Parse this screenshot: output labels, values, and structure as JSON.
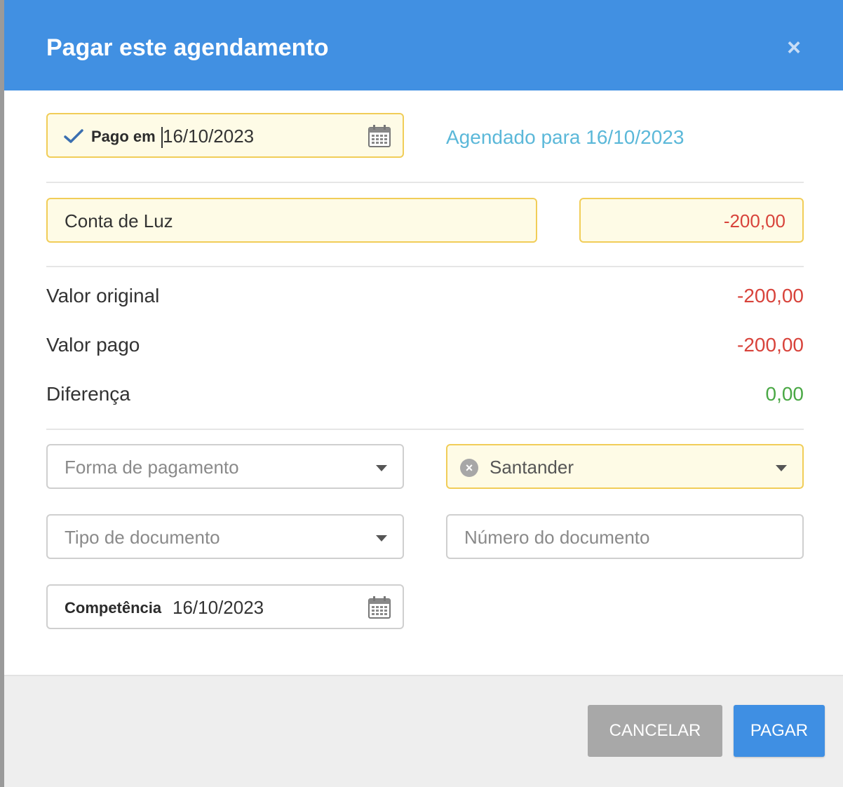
{
  "modal": {
    "title": "Pagar este agendamento",
    "close_label": "×"
  },
  "paid_on": {
    "label": "Pago em",
    "date": "16/10/2023",
    "icon": "calendar-icon"
  },
  "scheduled_text": "Agendado para 16/10/2023",
  "description": "Conta de Luz",
  "amount": "-200,00",
  "summary": {
    "original_label": "Valor original",
    "original_value": "-200,00",
    "paid_label": "Valor pago",
    "paid_value": "-200,00",
    "difference_label": "Diferença",
    "difference_value": "0,00"
  },
  "payment_method": {
    "placeholder": "Forma de pagamento"
  },
  "account": {
    "selected": "Santander"
  },
  "document_type": {
    "placeholder": "Tipo de documento"
  },
  "document_number": {
    "placeholder": "Número do documento"
  },
  "competence": {
    "label": "Competência",
    "date": "16/10/2023"
  },
  "footer": {
    "cancel_label": "CANCELAR",
    "pay_label": "PAGAR"
  },
  "colors": {
    "header": "#4190e2",
    "highlight_border": "#f1cd58",
    "highlight_bg": "#fefbe6",
    "negative": "#d8433b",
    "positive": "#4aa845",
    "link": "#5bb8d9"
  }
}
